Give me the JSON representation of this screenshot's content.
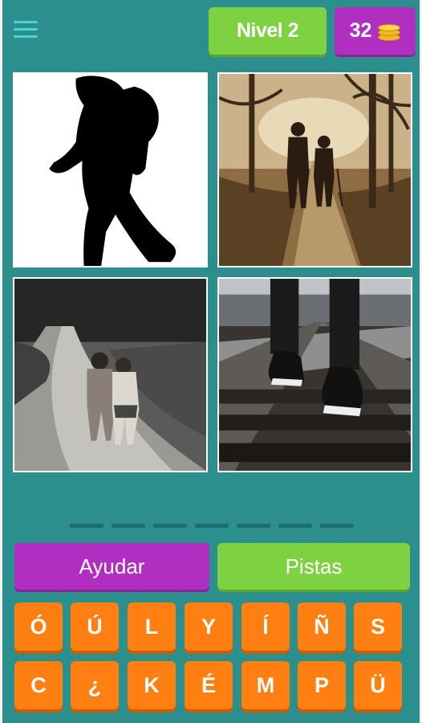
{
  "header": {
    "menu_icon": "hamburger-menu-icon",
    "level_label": "Nivel 2",
    "coins": "32",
    "coin_icon": "coin-stack-icon"
  },
  "images": [
    {
      "name": "photo-silhouette-walker"
    },
    {
      "name": "photo-elderly-couple-path"
    },
    {
      "name": "photo-children-dirt-road"
    },
    {
      "name": "photo-sneakers-railroad"
    }
  ],
  "answer": {
    "slot_count": 7
  },
  "buttons": {
    "help_label": "Ayudar",
    "hints_label": "Pistas"
  },
  "keys": {
    "row1": [
      "Ó",
      "Ú",
      "L",
      "Y",
      "Í",
      "Ñ",
      "S"
    ],
    "row2": [
      "C",
      "¿",
      "K",
      "É",
      "M",
      "P",
      "Ü"
    ]
  },
  "colors": {
    "background": "#2a8f8d",
    "green": "#7ed13f",
    "purple": "#b12fc0",
    "orange": "#ff7f11"
  }
}
